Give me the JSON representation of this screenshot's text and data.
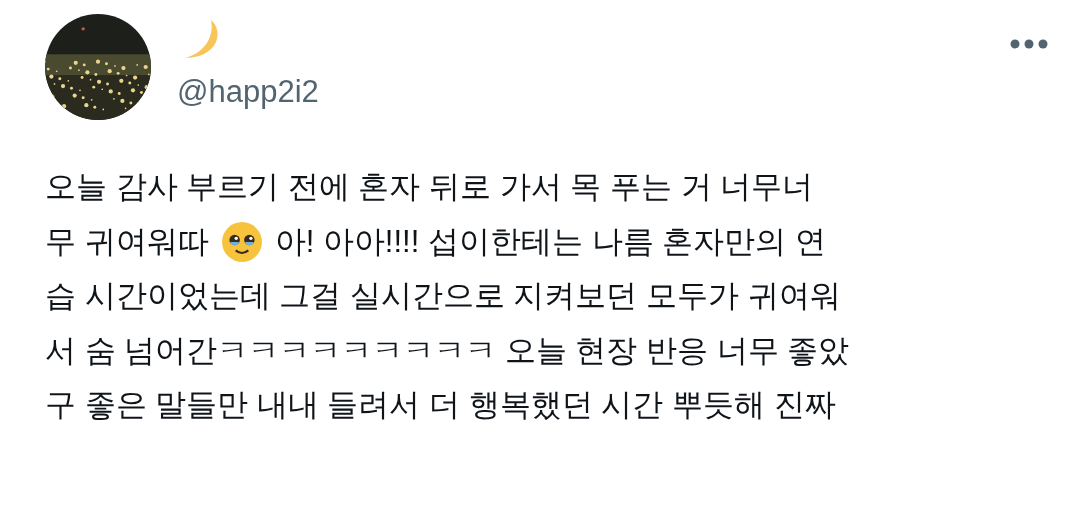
{
  "author": {
    "handle": "@happ2i2"
  },
  "post": {
    "lines": [
      [
        {
          "kind": "text",
          "text": "오늘 감사 부르기 전에 혼자 뒤로 가서 목 푸는 거 너무너"
        }
      ],
      [
        {
          "kind": "text",
          "text": "무 귀여워따"
        },
        {
          "kind": "emoji"
        },
        {
          "kind": "text",
          "text": "아! 아아!!!! 섭이한테는 나름 혼자만의 연"
        }
      ],
      [
        {
          "kind": "text",
          "text": "습 시간이었는데 그걸 실시간으로 지켜보던 모두가 귀여워"
        }
      ],
      [
        {
          "kind": "text",
          "text": "서 숨 넘어간ㅋㅋㅋㅋㅋㅋㅋㅋㅋ 오늘 현장 반응 너무 좋았"
        }
      ],
      [
        {
          "kind": "text",
          "text": "구 좋은 말들만 내내 들려서 더 행복했던 시간 뿌듯해 진짜"
        }
      ]
    ]
  }
}
